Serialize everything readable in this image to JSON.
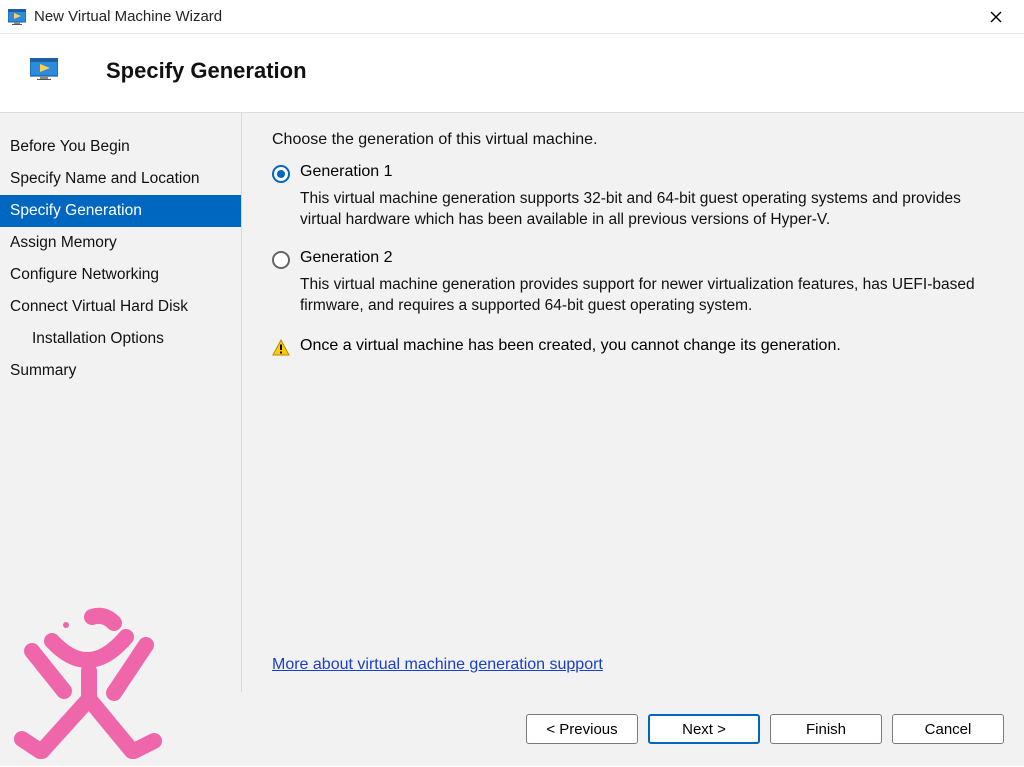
{
  "window": {
    "title": "New Virtual Machine Wizard"
  },
  "header": {
    "title": "Specify Generation"
  },
  "sidebar": {
    "steps": [
      "Before You Begin",
      "Specify Name and Location",
      "Specify Generation",
      "Assign Memory",
      "Configure Networking",
      "Connect Virtual Hard Disk",
      "Installation Options",
      "Summary"
    ],
    "active_index": 2,
    "indent_index": 6
  },
  "content": {
    "prompt": "Choose the generation of this virtual machine.",
    "options": [
      {
        "label": "Generation 1",
        "desc": "This virtual machine generation supports 32-bit and 64-bit guest operating systems and provides virtual hardware which has been available in all previous versions of Hyper-V.",
        "selected": true
      },
      {
        "label": "Generation 2",
        "desc": "This virtual machine generation provides support for newer virtualization features, has UEFI-based firmware, and requires a supported 64-bit guest operating system.",
        "selected": false
      }
    ],
    "warning": "Once a virtual machine has been created, you cannot change its generation.",
    "more_link": "More about virtual machine generation support"
  },
  "footer": {
    "previous": "< Previous",
    "next": "Next >",
    "finish": "Finish",
    "cancel": "Cancel"
  }
}
